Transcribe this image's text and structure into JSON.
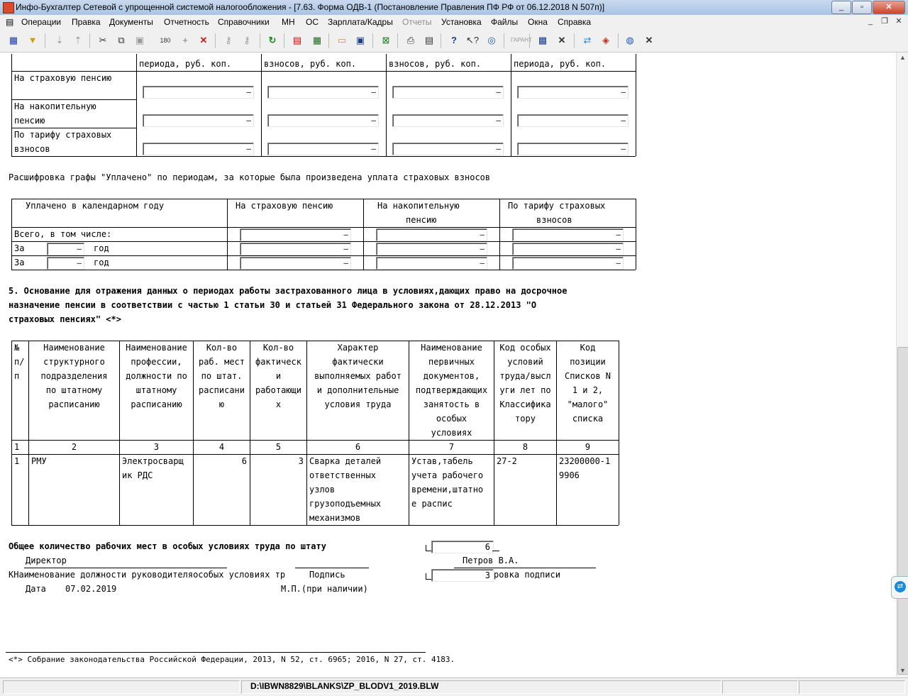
{
  "window": {
    "title": "Инфо-Бухгалтер Сетевой с упрощенной системой налогообложения - [7.63. Форма ОДВ-1 (Постановление Правления ПФ РФ от 06.12.2018 N 507п)]"
  },
  "menu": [
    "Операции",
    "Правка",
    "Документы",
    "Отчетность",
    "Справочники",
    "МН",
    "ОС",
    "Зарплата/Кадры",
    "Отчеты",
    "Установка",
    "Файлы",
    "Окна",
    "Справка"
  ],
  "top_table": {
    "headers": [
      "периода, руб. коп.",
      "взносов, руб. коп.",
      "взносов, руб. коп.",
      "периода, руб. коп."
    ],
    "row1": "На страховую пенсию",
    "row2a": "На накопительную",
    "row2b": "пенсию",
    "row3a": "По тарифу страховых",
    "row3b": "взносов",
    "dash": "–"
  },
  "decode": {
    "heading": "Расшифровка графы \"Уплачено\" по периодам, за которые была произведена уплата страховых взносов",
    "col1": "Уплачено в календарном году",
    "col2": "На страховую пенсию",
    "col3a": "На накопительную",
    "col3b": "пенсию",
    "col4a": "По тарифу страховых",
    "col4b": "взносов",
    "total": "Всего, в том числе:",
    "za": "За",
    "god": "год"
  },
  "section5": {
    "line1": "5. Основание для отражения данных о периодах работы застрахованного лица в условиях,дающих право на досрочное",
    "line2": "назначение пенсии в соответствии с частью 1 статьи 30 и статьей 31 Федерального закона от 28.12.2013 \"О",
    "line3": "страховых пенсиях\" <*>"
  },
  "grid": {
    "h1": [
      "№",
      "п/",
      "п"
    ],
    "h2": [
      "Наименование",
      "структурного",
      "подразделения",
      "по штатному",
      "расписанию"
    ],
    "h3": [
      "Наименование",
      "профессии,",
      "должности по",
      "штатному",
      "расписанию"
    ],
    "h4": [
      "Кол-во",
      "раб. мест",
      "по штат.",
      "расписани",
      "ю"
    ],
    "h5": [
      "Кол-во",
      "фактическ",
      "и",
      "работающи",
      "х"
    ],
    "h6": [
      "Характер",
      "фактически",
      "выполняемых работ",
      "и дополнительные",
      "условия труда"
    ],
    "h7": [
      "Наименование",
      "первичных",
      "документов,",
      "подтверждающих",
      "занятость в",
      "особых",
      "условиях"
    ],
    "h8": [
      "Код особых",
      "условий",
      "труда/высл",
      "уги лет по",
      "Классифика",
      "тору"
    ],
    "h9": [
      "Код",
      "позиции",
      "Списков N",
      "1 и 2,",
      "\"малого\"",
      "списка"
    ],
    "nums": [
      "1",
      "2",
      "3",
      "4",
      "5",
      "6",
      "7",
      "8",
      "9"
    ],
    "row": {
      "n": "1",
      "unit": "РМУ",
      "prof": [
        "Электросварщ",
        "ик РДС"
      ],
      "places": "6",
      "actual": "3",
      "work": [
        "Сварка деталей",
        "ответственных",
        "узлов",
        "грузоподъемных",
        "механизмов"
      ],
      "docs": [
        "Устав,табель",
        "учета рабочего",
        "времени,штатно",
        "е распис"
      ],
      "code": "27-2",
      "pos": [
        "23200000-1",
        "9906"
      ]
    }
  },
  "footer": {
    "total_label": "Общее количество рабочих мест в особых условиях труда по штату",
    "total_value": "6",
    "director": "Директор",
    "signer": "Петров В.А.",
    "line_overlap": "КНаименование должности руководителяособых условиях тр",
    "podpis": "Подпись",
    "actual_value": "3",
    "rasshifrovka": "ровка подписи",
    "date_label": "Дата",
    "date_value": "07.02.2019",
    "mp": "М.П.(при наличии)",
    "footnote": "<*> Собрание законодательства Российской Федерации, 2013, N 52, ст. 6965; 2016, N 27, ст. 4183."
  },
  "status": {
    "path": "D:\\IBWN8829\\BLANKS\\ZP_BLODV1_2019.BLW"
  }
}
